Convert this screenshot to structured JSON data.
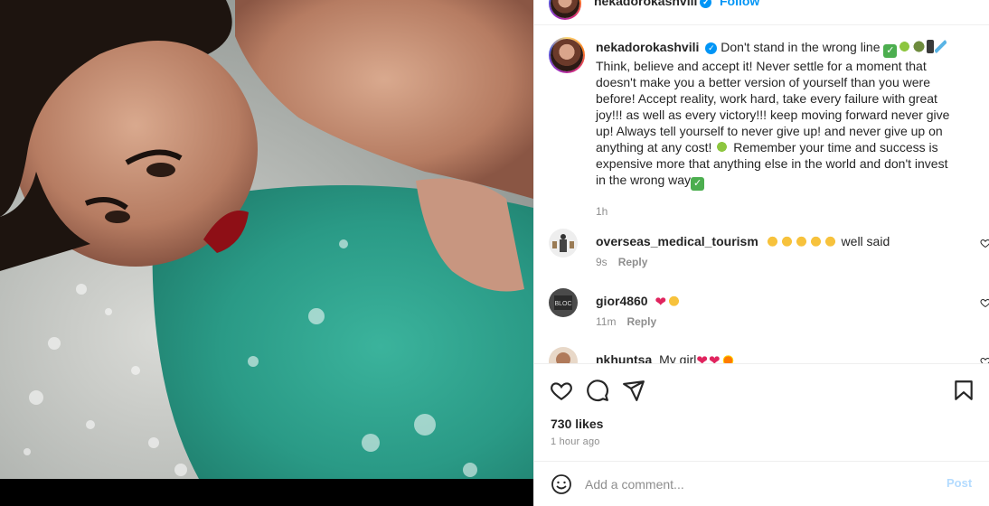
{
  "post": {
    "author": "nekadorokashvili",
    "follow_label": "Follow",
    "caption_text": "Don't stand in the wrong line ✅ Think, believe and accept it! Never settle for a moment that doesn't make you a better version of yourself than you were before! Accept reality, work hard, take every failure with great joy!!! as well as every victory!!! keep moving forward never give up! Always tell yourself to never give up! and never give up on anything at any cost! Remember your time and success is expensive more that anything else in the world and don't invest in the wrong way✅",
    "caption_line1": "Don't stand in the wrong line",
    "caption_line2": "Think, believe and accept it! Never settle for a moment that doesn't make you a better version of yourself than you were before! Accept reality, work hard, take every failure with great joy!!! as well as every victory!!! keep moving forward never give up! Always tell yourself to never give up! and never give up on anything at any cost!",
    "caption_line3": "Remember your time and success is expensive more that anything else in the world and don't invest in the wrong way",
    "caption_time": "1h",
    "likes": "730 likes",
    "posted_ago": "1 hour ago"
  },
  "comments": [
    {
      "user": "overseas_medical_tourism",
      "text": "well said",
      "time": "9s",
      "reply_label": "Reply"
    },
    {
      "user": "gior4860",
      "text": "",
      "time": "11m",
      "reply_label": "Reply"
    },
    {
      "user": "nkhuntsa",
      "text": "My girl",
      "time": "",
      "reply_label": ""
    }
  ],
  "comment_box": {
    "placeholder": "Add a comment...",
    "post_label": "Post"
  },
  "icons": {
    "like": "heart-icon",
    "comment": "comment-icon",
    "share": "share-icon",
    "save": "bookmark-icon",
    "emoji": "smiley-icon",
    "verified": "verified-badge-icon"
  },
  "colors": {
    "accent": "#0095f6",
    "post_disabled": "#b3dbff",
    "text_secondary": "#8e8e8e",
    "water": "#2fa58f"
  }
}
